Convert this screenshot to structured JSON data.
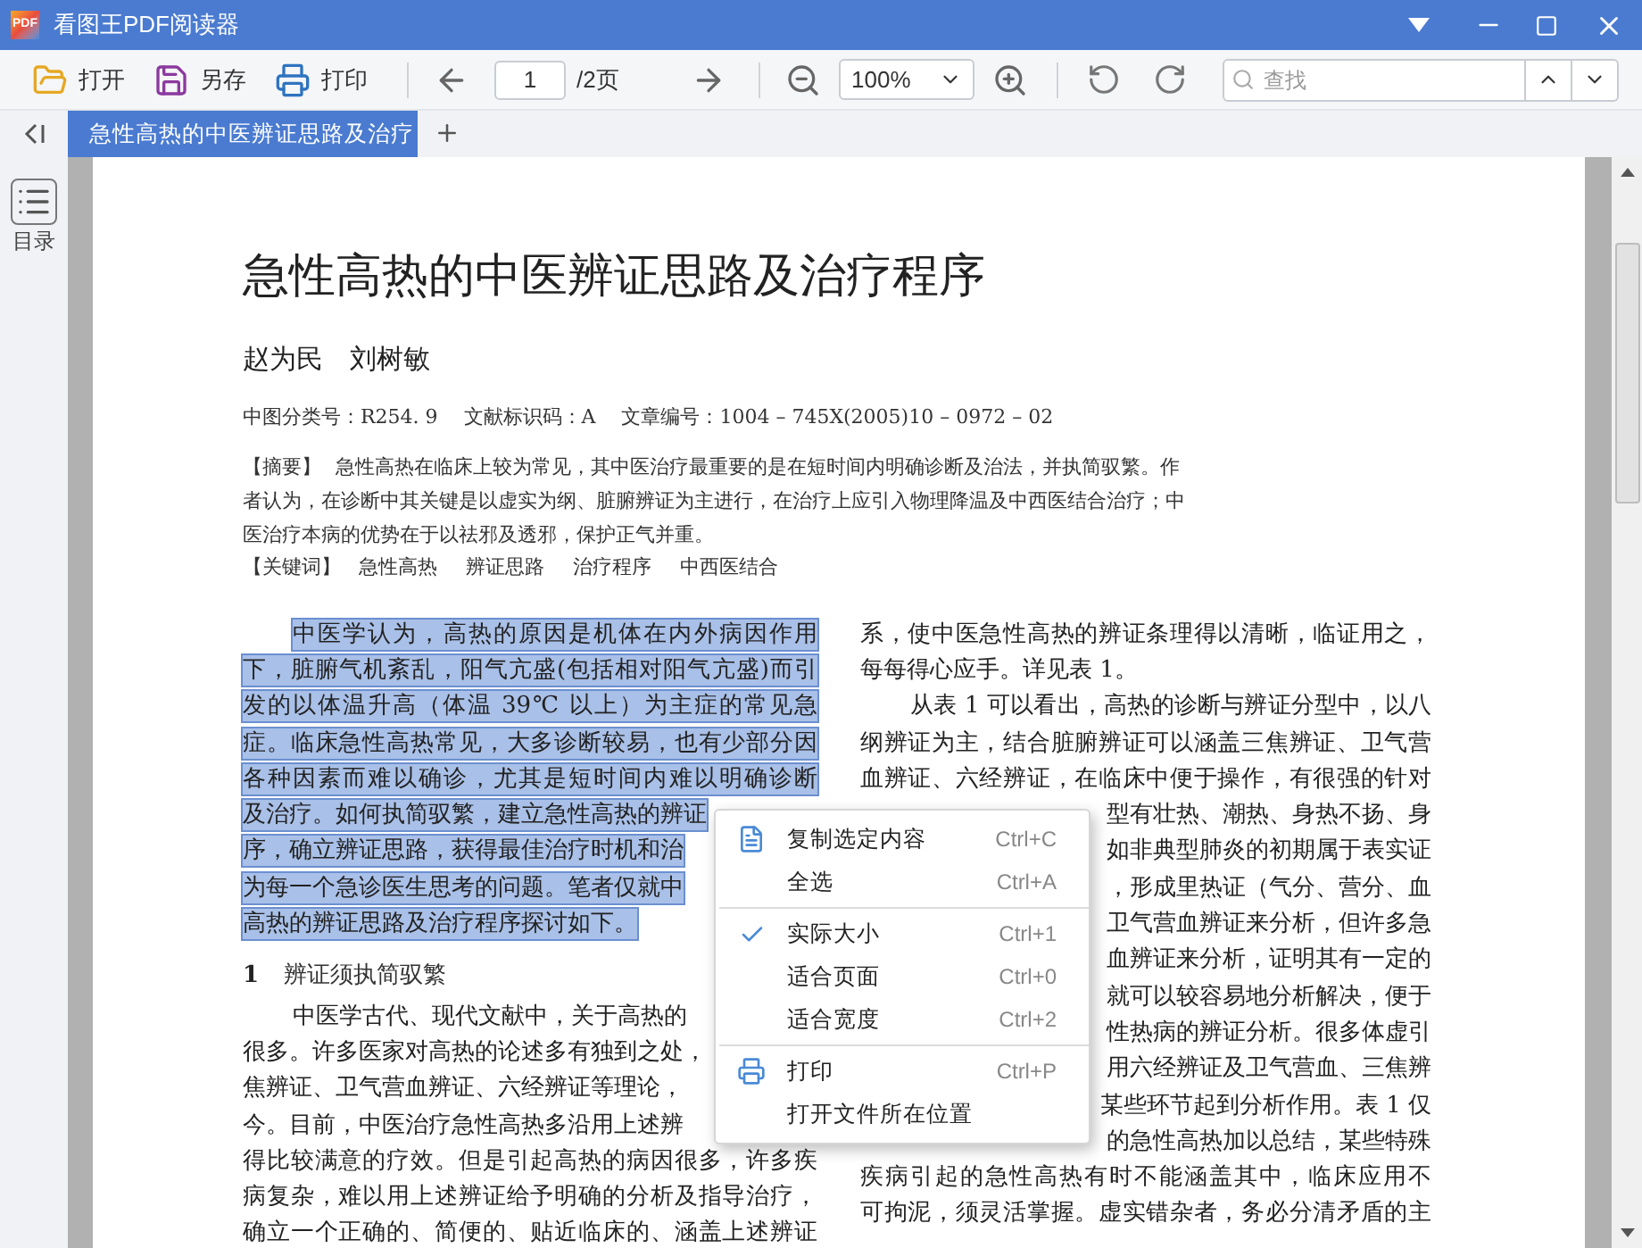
{
  "window": {
    "logo_text": "PDF",
    "title": "看图王PDF阅读器"
  },
  "toolbar": {
    "buttons": [
      {
        "kind": "open",
        "label": "打开"
      },
      {
        "kind": "save",
        "label": "另存"
      },
      {
        "kind": "print",
        "label": "打印"
      }
    ],
    "page_input": "1",
    "page_total": "/2页",
    "zoom": "100%",
    "search": {
      "placeholder": "查找"
    }
  },
  "tabs": [
    {
      "label": "急性高热的中医辨证思路及治疗",
      "selected": true
    }
  ],
  "sidebar": {
    "label": "目录"
  },
  "document": {
    "title": "急性高热的中医辨证思路及治疗程序",
    "authors": "赵为民　刘树敏",
    "meta": "中图分类号：R254. 9　 文献标识码：A　 文章编号：1004 – 745X(2005)10 – 0972 – 02",
    "abstract_label": "【摘要】",
    "abstract_lines": [
      "急性高热在临床上较为常见，其中医治疗最重要的是在短时间内明确诊断及治法，并执简驭繁。作",
      "者认为，在诊断中其关键是以虚实为纲、脏腑辨证为主进行，在治疗上应引入物理降温及中西医结合治疗；中",
      "医治疗本病的优势在于以祛邪及透邪，保护正气并重。"
    ],
    "keywords_label": "【关键词】",
    "keywords": [
      "急性高热",
      "辨证思路",
      "治疗程序",
      "中西医结合"
    ],
    "left_column": [
      {
        "kind": "indent",
        "text": "中医学认为，高热的原因是机体在内外病因作用",
        "selected": true
      },
      {
        "kind": "line",
        "text": "下，脏腑气机紊乱，阳气亢盛(包括相对阳气亢盛)而引",
        "selected": true
      },
      {
        "kind": "line",
        "text": "发的以体温升高（体温 39℃ 以上）为主症的常见急",
        "selected": true
      },
      {
        "kind": "line",
        "text": "症。临床急性高热常见，大多诊断较易，也有少部分因",
        "selected": true
      },
      {
        "kind": "line",
        "text": "各种因素而难以确诊，尤其是短时间内难以明确诊断",
        "selected": true
      },
      {
        "kind": "partial",
        "text": "及治疗。如何执简驭繁，建立急性高热的辨证",
        "selected": true
      },
      {
        "kind": "partial",
        "text": "序，确立辨证思路，获得最佳治疗时机和治",
        "selected": true
      },
      {
        "kind": "partial",
        "text": "为每一个急诊医生思考的问题。笔者仅就中",
        "selected": true
      },
      {
        "kind": "last",
        "text": "高热的辨证思路及治疗程序探讨如下。",
        "selected": true
      },
      {
        "kind": "heading",
        "number": "1",
        "text": "辨证须执简驭繁"
      },
      {
        "kind": "indent_partial",
        "text": "中医学古代、现代文献中，关于高热的",
        "selected": false
      },
      {
        "kind": "partial",
        "text": "很多。许多医家对高热的论述多有独到之处，",
        "selected": false
      },
      {
        "kind": "partial",
        "text": "焦辨证、卫气营血辨证、六经辨证等理论，",
        "selected": false
      },
      {
        "kind": "partial",
        "text": "今。目前，中医治疗急性高热多沿用上述辨",
        "selected": false
      },
      {
        "kind": "line",
        "text": "得比较满意的疗效。但是引起高热的病因很多，许多疾",
        "selected": false
      },
      {
        "kind": "line",
        "text": "病复杂，难以用上述辨证给予明确的分析及指导治疗，",
        "selected": false
      },
      {
        "kind": "line",
        "text": "确立一个正确的、简便的、贴近临床的、涵盖上述辨证",
        "selected": false
      }
    ],
    "right_column": [
      {
        "kind": "line",
        "text": "系，使中医急性高热的辨证条理得以清晰，临证用之，"
      },
      {
        "kind": "last",
        "text": "每每得心应手。详见表 1。"
      },
      {
        "kind": "indent",
        "text": "从表 1 可以看出，高热的诊断与辨证分型中，以八"
      },
      {
        "kind": "line",
        "text": "纲辨证为主，结合脏腑辨证可以涵盖三焦辨证、卫气营"
      },
      {
        "kind": "line",
        "text": "血辨证、六经辨证，在临床中便于操作，有很强的针对"
      },
      {
        "kind": "partial",
        "text": "型有壮热、潮热、身热不扬、身"
      },
      {
        "kind": "partial",
        "text": "如非典型肺炎的初期属于表实证"
      },
      {
        "kind": "partial",
        "text": "，形成里热证（气分、营分、血"
      },
      {
        "kind": "partial",
        "text": "卫气营血辨证来分析，但许多急"
      },
      {
        "kind": "partial",
        "text": "血辨证来分析，证明其有一定的"
      },
      {
        "kind": "partial",
        "text": "就可以较容易地分析解决，便于"
      },
      {
        "kind": "partial",
        "text": "性热病的辨证分析。很多体虚引"
      },
      {
        "kind": "partial",
        "text": "用六经辨证及卫气营血、三焦辨"
      },
      {
        "kind": "partial",
        "text": "某些环节起到分析作用。表 1 仅"
      },
      {
        "kind": "partial",
        "text": "的急性高热加以总结，某些特殊"
      },
      {
        "kind": "line",
        "text": "疾病引起的急性高热有时不能涵盖其中，临床应用不"
      },
      {
        "kind": "line",
        "text": "可拘泥，须灵活掌握。虚实错杂者，务必分清矛盾的主"
      }
    ]
  },
  "context_menu": [
    {
      "kind": "copy",
      "label": "复制选定内容",
      "shortcut": "Ctrl+C",
      "checked": false
    },
    {
      "kind": "plain",
      "label": "全选",
      "shortcut": "Ctrl+A",
      "checked": false,
      "separator_after": true
    },
    {
      "kind": "plain",
      "label": "实际大小",
      "shortcut": "Ctrl+1",
      "checked": true
    },
    {
      "kind": "plain",
      "label": "适合页面",
      "shortcut": "Ctrl+0",
      "checked": false
    },
    {
      "kind": "plain",
      "label": "适合宽度",
      "shortcut": "Ctrl+2",
      "checked": false,
      "separator_after": true
    },
    {
      "kind": "print",
      "label": "打印",
      "shortcut": "Ctrl+P",
      "checked": false
    },
    {
      "kind": "plain",
      "label": "打开文件所在位置",
      "checked": false
    }
  ]
}
